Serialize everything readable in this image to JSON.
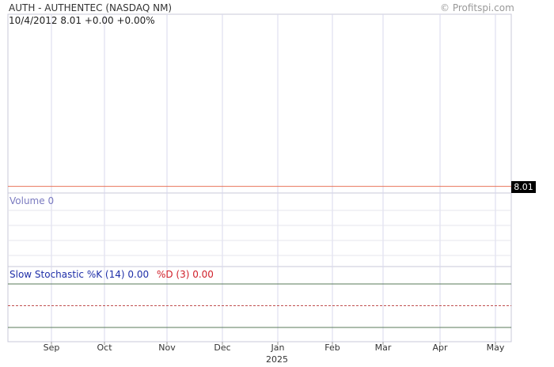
{
  "header": {
    "title": "AUTH - AUTHENTEC (NASDAQ NM)",
    "watermark": "© Profitspi.com",
    "quote": "10/4/2012  8.01 +0.00 +0.00%"
  },
  "price_tag": "8.01",
  "volume_label": "Volume  0",
  "stochastic": {
    "k_label": "Slow Stochastic %K (14) 0.00",
    "d_label": "%D (3) 0.00"
  },
  "colors": {
    "price_line": "#e8735a",
    "grid": "#d8d8ee",
    "stoch_line": "#5a7a5a",
    "stoch_mid": "#c05050"
  },
  "chart_data": {
    "type": "line",
    "x_ticks": [
      "Sep",
      "Oct",
      "Nov",
      "Dec",
      "Jan",
      "Feb",
      "Mar",
      "Apr",
      "May"
    ],
    "year_label": "2025",
    "series": [
      {
        "values": [
          8.01,
          8.01,
          8.01,
          8.01,
          8.01,
          8.01,
          8.01,
          8.01,
          8.01,
          8.01
        ]
      }
    ],
    "volume": 0,
    "stochastic_k": 0.0,
    "stochastic_d": 0.0,
    "grid": true
  }
}
